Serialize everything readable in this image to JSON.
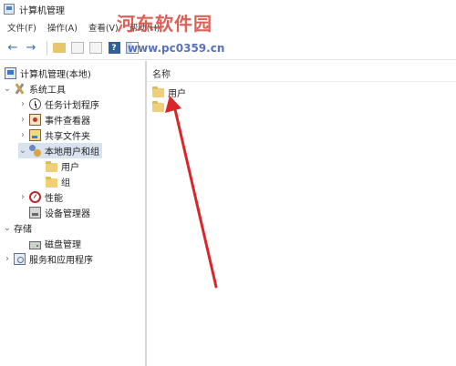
{
  "window": {
    "title": "计算机管理"
  },
  "menu": {
    "items": [
      "文件(F)",
      "操作(A)",
      "查看(V)",
      "帮助(H)"
    ]
  },
  "watermark": {
    "title": "河东软件园",
    "url": "www.pc0359.cn"
  },
  "tree": {
    "root": "计算机管理(本地)",
    "system_tools": "系统工具",
    "task_scheduler": "任务计划程序",
    "event_viewer": "事件查看器",
    "shared_folders": "共享文件夹",
    "local_users_groups": "本地用户和组",
    "users": "用户",
    "groups": "组",
    "performance": "性能",
    "device_manager": "设备管理器",
    "storage": "存储",
    "disk_management": "磁盘管理",
    "services_apps": "服务和应用程序"
  },
  "list": {
    "column_name": "名称",
    "items": [
      "用户",
      ""
    ]
  },
  "annotation": {
    "arrow_color": "#d9262b"
  }
}
